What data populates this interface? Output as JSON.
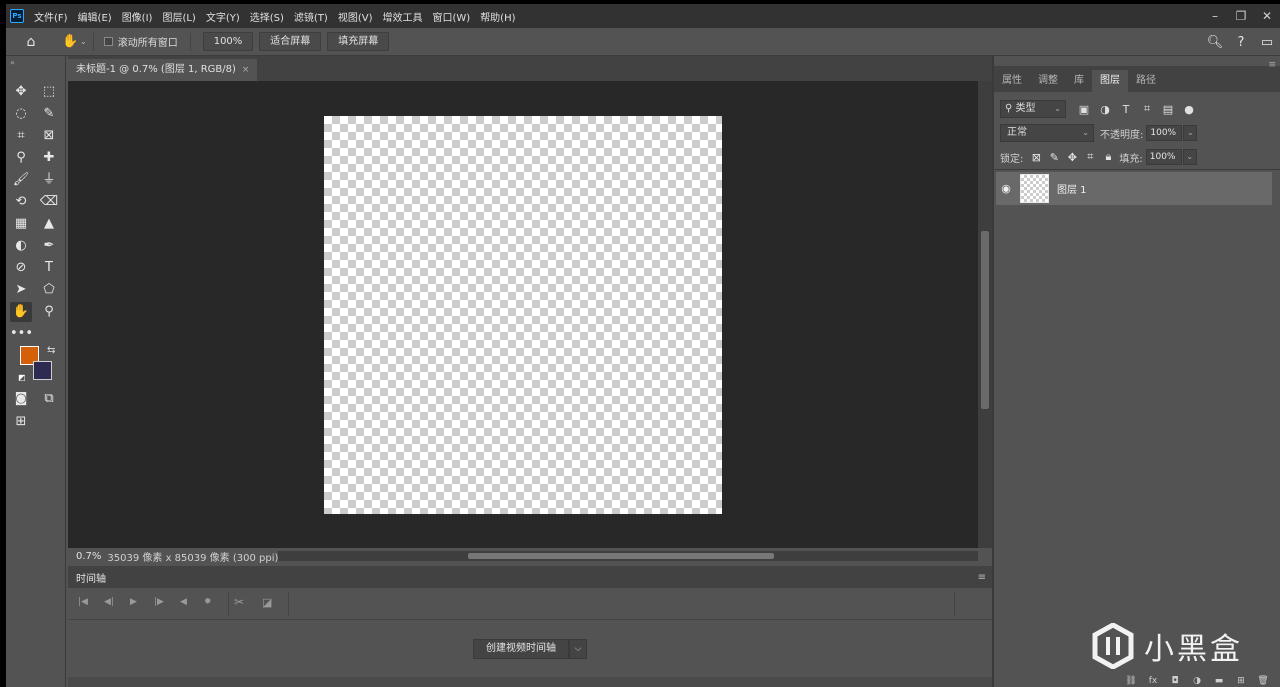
{
  "menu": {
    "logo": "Ps",
    "items": [
      "文件(F)",
      "编辑(E)",
      "图像(I)",
      "图层(L)",
      "文字(Y)",
      "选择(S)",
      "滤镜(T)",
      "视图(V)",
      "增效工具",
      "窗口(W)",
      "帮助(H)"
    ],
    "window_controls": [
      "–",
      "❐",
      "✕"
    ]
  },
  "options": {
    "scroll_all_label": "滚动所有窗口",
    "zoom_btn": "100%",
    "fit_screen": "适合屏幕",
    "fill_screen": "填充屏幕"
  },
  "toolbar": {
    "collapse": "«",
    "foreground_color": "#d4600a",
    "background_color": "#2d2b52"
  },
  "document": {
    "tab_title": "未标题-1 @ 0.7% (图层 1, RGB/8)",
    "close": "×",
    "zoom": "0.7%",
    "info": "35039 像素 x 85039 像素 (300 ppi)",
    "status_caret": "‹"
  },
  "timeline": {
    "title": "时间轴",
    "menu": "≡",
    "create_button": "创建视频时间轴",
    "create_caret": "⌵"
  },
  "panel": {
    "tabs": [
      "属性",
      "调整",
      "库",
      "图层",
      "路径"
    ],
    "active_tab": "图层",
    "menu": "≡",
    "filter_kind": "类型",
    "blend_mode": "正常",
    "opacity_label": "不透明度:",
    "opacity": "100%",
    "lock_label": "锁定:",
    "fill_label": "填充:",
    "fill": "100%",
    "layers": [
      {
        "name": "图层 1",
        "visible": true
      }
    ]
  },
  "watermark": {
    "text": "小黑盒"
  }
}
